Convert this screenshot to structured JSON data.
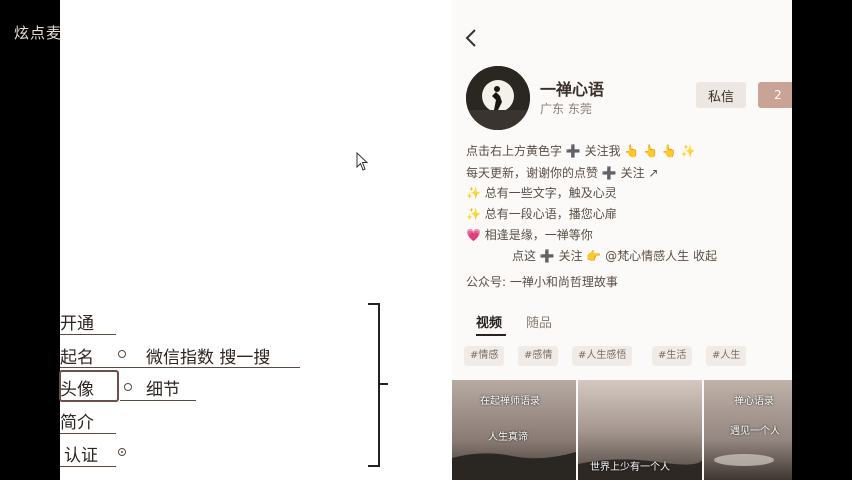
{
  "watermark": "炫点麦",
  "mindmap": {
    "items": [
      {
        "label": "开通"
      },
      {
        "label": "起名",
        "note": "微信指数 搜一搜"
      },
      {
        "label": "头像",
        "note": "细节"
      },
      {
        "label": "简介"
      },
      {
        "label": "认证"
      }
    ]
  },
  "profile": {
    "username": "一禅心语",
    "location": "广东 东莞",
    "message_button": "私信",
    "follow_button": "2",
    "bio": [
      "点击右上方黄色字 ➕ 关注我 👆 👆 👆 ✨",
      "每天更新，谢谢你的点赞 ➕ 关注 ↗",
      "✨ 总有一些文字，触及心灵",
      "✨ 总有一段心语，播您心扉",
      "💗 相逢是缘，一禅等你",
      "点这 ➕ 关注 👉 @梵心情感人生  收起",
      "公众号: 一禅小和尚哲理故事"
    ],
    "tabs": [
      "视频",
      "随品"
    ],
    "tags": [
      "#情感",
      "#感情",
      "#人生感悟",
      "#生活",
      "#人生"
    ],
    "thumbs": [
      {
        "caption_top": "在起禅师语录",
        "caption_bottom": "人生真谛"
      },
      {
        "caption_top": "",
        "caption_bottom": "世界上少有一个人"
      },
      {
        "caption_top": "禅心语录",
        "caption_bottom": "遇见一个人"
      }
    ]
  },
  "colors": {
    "accent": "#c9a496",
    "background": "#fbfaf8",
    "ink": "#3a302a"
  },
  "icons": [
    "back-chevron-icon",
    "cursor-arrow-icon"
  ]
}
